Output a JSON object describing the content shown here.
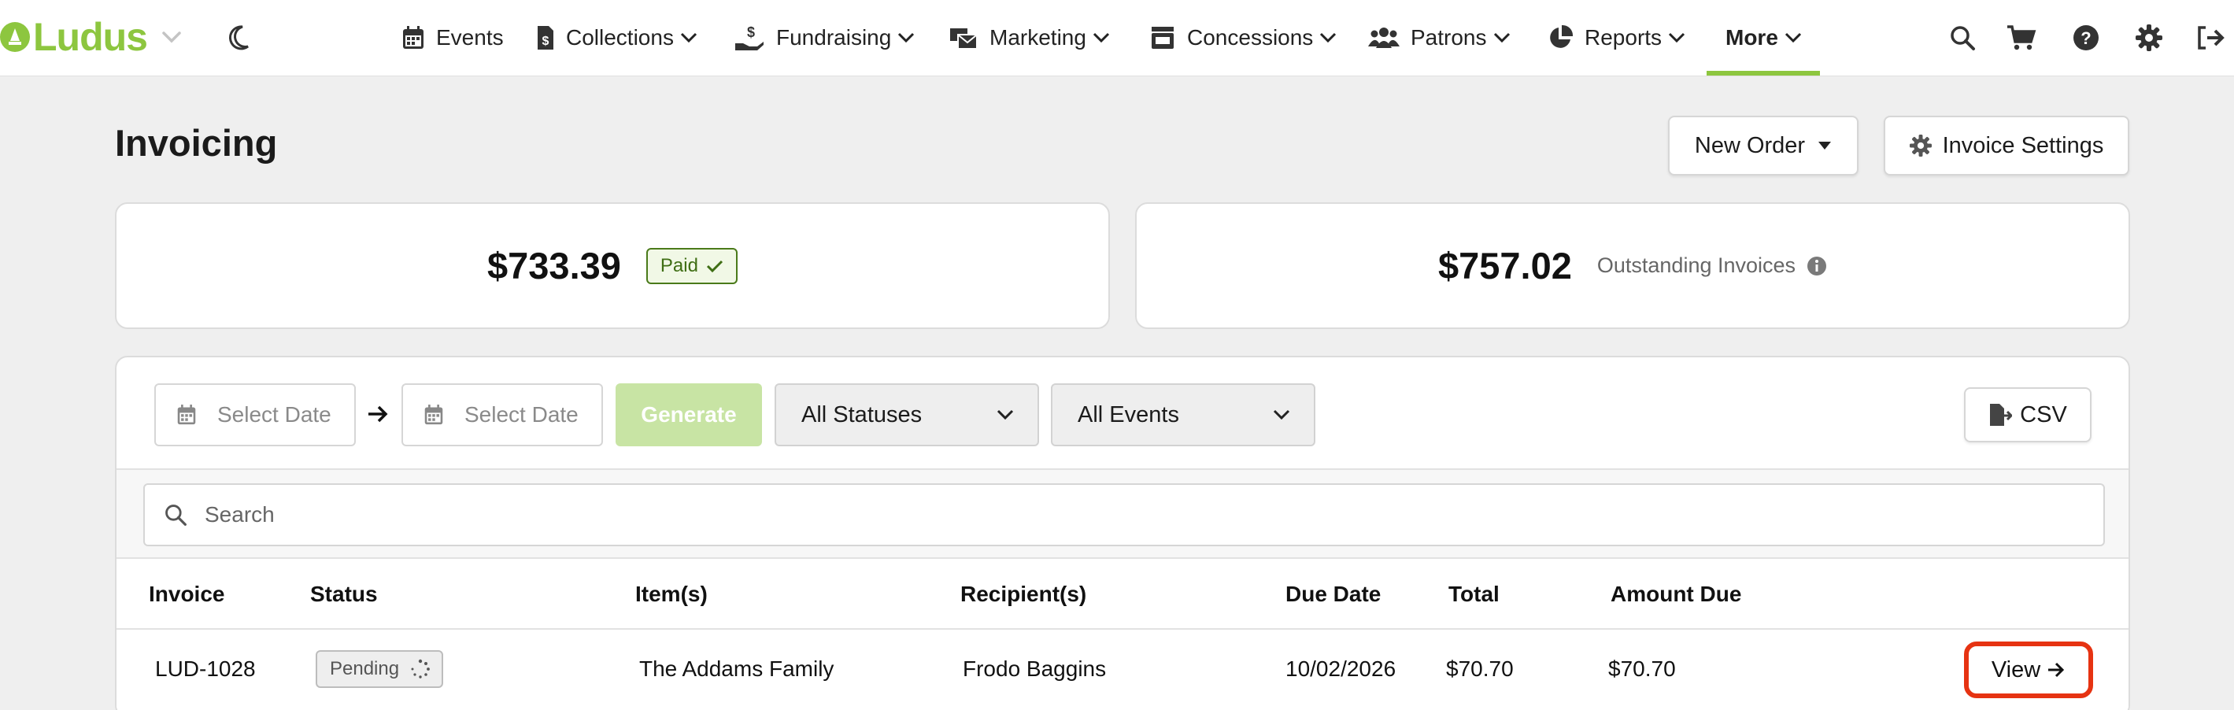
{
  "nav": {
    "brand": "Ludus",
    "items": [
      {
        "label": "Events",
        "icon": "calendar-icon"
      },
      {
        "label": "Collections",
        "icon": "file-dollar-icon"
      },
      {
        "label": "Fundraising",
        "icon": "hand-dollar-icon"
      },
      {
        "label": "Marketing",
        "icon": "mail-bulk-icon"
      },
      {
        "label": "Concessions",
        "icon": "store-icon"
      },
      {
        "label": "Patrons",
        "icon": "users-icon"
      },
      {
        "label": "Reports",
        "icon": "pie-chart-icon"
      },
      {
        "label": "More",
        "icon": null,
        "active": true
      }
    ],
    "right_icons": [
      "search-icon",
      "cart-icon",
      "help-icon",
      "gear-icon",
      "logout-icon"
    ]
  },
  "header": {
    "title": "Invoicing",
    "new_order_label": "New Order",
    "invoice_settings_label": "Invoice Settings"
  },
  "summary": {
    "paid_amount": "$733.39",
    "paid_badge": "Paid",
    "outstanding_amount": "$757.02",
    "outstanding_label": "Outstanding Invoices"
  },
  "filters": {
    "date_from_placeholder": "Select Date",
    "date_to_placeholder": "Select Date",
    "generate_label": "Generate",
    "status_select": "All Statuses",
    "events_select": "All Events",
    "csv_label": "CSV"
  },
  "search": {
    "placeholder": "Search"
  },
  "table": {
    "columns": [
      "Invoice",
      "Status",
      "Item(s)",
      "Recipient(s)",
      "Due Date",
      "Total",
      "Amount Due"
    ],
    "rows": [
      {
        "invoice": "LUD-1028",
        "status": "Pending",
        "items": "The Addams Family",
        "recipient": "Frodo Baggins",
        "due_date": "10/02/2026",
        "total": "$70.70",
        "amount_due": "$70.70",
        "action": "View"
      }
    ]
  },
  "colors": {
    "brand_green": "#8dc63f",
    "highlight_red": "#e63312",
    "paid_green": "#3f6e14"
  }
}
